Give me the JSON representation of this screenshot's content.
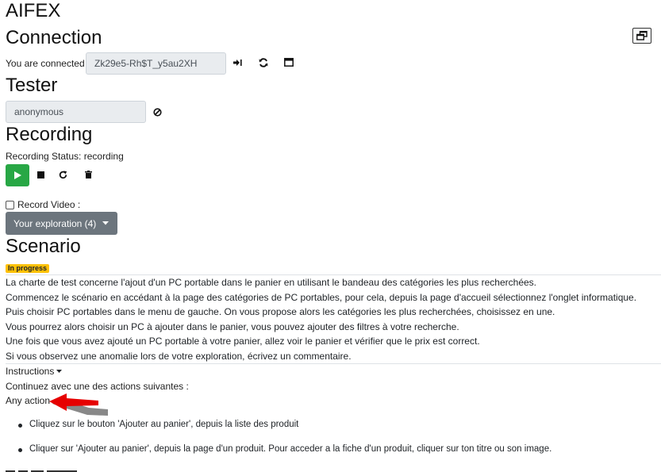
{
  "app": {
    "title": "AIFEX"
  },
  "connection": {
    "heading": "Connection",
    "status_label": "You are connected",
    "session_value": "Zk29e5-Rh$T_y5au2XH",
    "icons": [
      "sign-out-icon",
      "sync-icon",
      "window-icon"
    ],
    "popout_icon": "popout-windows-icon"
  },
  "tester": {
    "heading": "Tester",
    "name_value": "anonymous",
    "clear_icon": "ban-icon"
  },
  "recording": {
    "heading": "Recording",
    "status_text": "Recording Status: recording",
    "controls": [
      "play-icon",
      "stop-icon",
      "restart-icon",
      "trash-icon"
    ],
    "record_video_label": "Record Video :",
    "record_video_checked": false,
    "exploration_dropdown": "Your exploration (4)"
  },
  "scenario": {
    "heading": "Scenario",
    "badge": "In progress",
    "badge_color": "#ffc107",
    "lines": [
      "La charte de test concerne l'ajout d'un PC portable dans le panier en utilisant le bandeau des catégories les plus recherchées.",
      "Commencez le scénario en accédant à la page des catégories de PC portables, pour cela, depuis la page d'accueil sélectionnez l'onglet informatique.",
      "Puis choisir PC portables dans le menu de gauche. On vous propose alors les catégories les plus recherchées, choisissez en une.",
      "Vous pourrez alors choisir un PC à ajouter dans le panier, vous pouvez ajouter des filtres à votre recherche.",
      "Une fois que vous avez ajouté un PC portable à votre panier, allez voir le panier et vérifier que le prix est correct.",
      "Si vous observez une anomalie lors de votre exploration, écrivez un commentaire."
    ]
  },
  "instructions": {
    "toggle_label": "Instructions",
    "continue_text": "Continuez avec une des actions suivantes :",
    "any_action": "Any action",
    "actions": [
      "Cliquez sur le bouton 'Ajouter au panier', depuis la liste des produit",
      "Cliquer sur 'Ajouter au panier', depuis la page d'un produit. Pour acceder a la fiche d'un produit, cliquer sur ton titre ou son image."
    ]
  },
  "colors": {
    "play_green": "#28a745",
    "dropdown_gray": "#6c757d",
    "arrow_red": "#e60000"
  }
}
